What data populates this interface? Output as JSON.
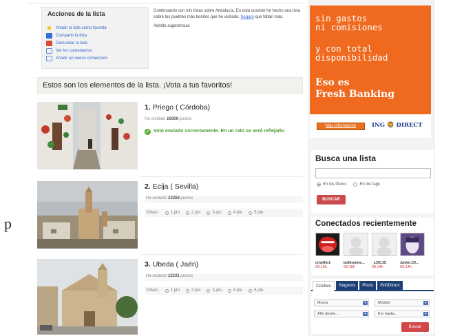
{
  "stray_text": "p",
  "acciones": {
    "title": "Acciones de la lista",
    "items": [
      {
        "label": "Añadir la lista como favorita",
        "icon": "star-icon"
      },
      {
        "label": "Compartir la lista",
        "icon": "share-icon"
      },
      {
        "label": "Denunciar la lista",
        "icon": "flag-icon"
      },
      {
        "label": "Ver los comentarios",
        "icon": "comments-icon"
      },
      {
        "label": "Añadir un nuevo comentario",
        "icon": "add-comment-icon"
      }
    ]
  },
  "description": {
    "text": "Continuando con mis listas sobre Andalucía. En esta ocasión he hecho una lista sobre los pueblos más bonitos que he visitado.",
    "link": "Seguro",
    "text_after": "que faltan más.",
    "suggestion": "Admito sugerencias"
  },
  "favorites_bar": "Estos son los elementos de la lista. ¡Vota a tus favoritos!",
  "items": [
    {
      "number": "1.",
      "name": "Priego ( Córdoba)",
      "received_prefix": "Ha recibido",
      "points": "16958",
      "points_suffix": "puntos",
      "success": "Voto enviado correctamente. En un rato se verá reflejado."
    },
    {
      "number": "2.",
      "name": "Ecija ( Sevilla)",
      "received_prefix": "Ha recibido",
      "points": "15358",
      "points_suffix": "puntos",
      "vote_label": "Vótalo:",
      "options": [
        "1 pto",
        "2 pto",
        "3 pto",
        "4 pto",
        "5 pto"
      ]
    },
    {
      "number": "3.",
      "name": "Ubeda ( Jaén)",
      "received_prefix": "Ha recibido",
      "points": "15161",
      "points_suffix": "puntos",
      "vote_label": "Vótalo:",
      "options": [
        "1 pto",
        "2 pto",
        "3 pto",
        "4 pto",
        "5 pto"
      ]
    }
  ],
  "ad": {
    "line1": "sin gastos",
    "line2": "ni comisiones",
    "line3": "y con total",
    "line4": "disponibilidad",
    "line5": "Eso es",
    "line6": "Fresh Banking",
    "more_info": "Más información",
    "brand": "ING",
    "brand2": "DIRECT",
    "color": "#ef6a1f"
  },
  "search": {
    "title": "Busca una lista",
    "placeholder": "",
    "option_titles": "En los títulos",
    "option_tags": "En los tags",
    "button": "BUSCAR"
  },
  "connected": {
    "title": "Conectados recientemente",
    "users": [
      {
        "name": "cinefilo1",
        "time": "09:16h"
      },
      {
        "name": "bolbonete...",
        "time": "09:16h"
      },
      {
        "name": "_LDCJC_",
        "time": "09:14h"
      },
      {
        "name": "Javier.Ol...",
        "time": "09:14h"
      }
    ]
  },
  "cars": {
    "tabs": [
      "Coches",
      "Seguros",
      "Pisos",
      "INGDirect"
    ],
    "make": "Marca",
    "model": "Modelo",
    "year_from": "Año desde...",
    "km_to": "Km hasta...",
    "button": "Buscar"
  }
}
